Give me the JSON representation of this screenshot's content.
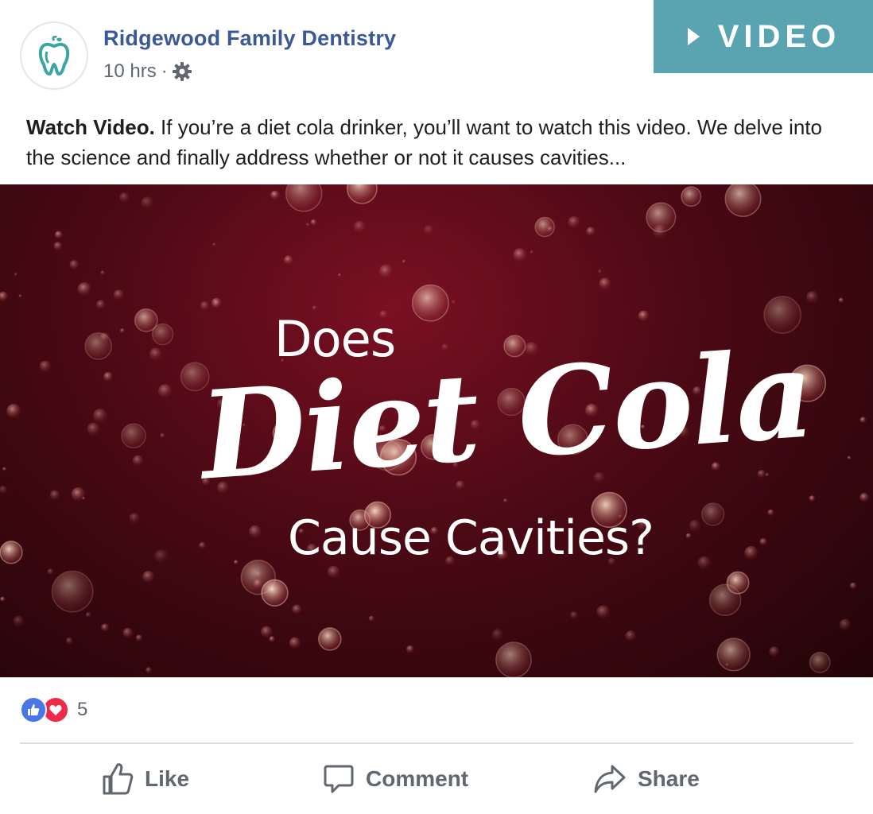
{
  "header": {
    "page_name": "Ridgewood Family Dentistry",
    "timestamp": "10 hrs",
    "separator": "·",
    "avatar_icon": "tooth-logo-icon",
    "privacy_icon": "gear-icon"
  },
  "badge": {
    "label": "VIDEO",
    "icon": "play-triangle-icon",
    "color": "#5aa3b1"
  },
  "post": {
    "lead": "Watch Video.",
    "body": " If you’re a diet cola drinker, you’ll want to watch this video. We delve into the science and finally address whether or not it causes cavities..."
  },
  "media": {
    "line1": "Does",
    "line2": "Diet Cola",
    "line3": "Cause Cavities?",
    "background_color": "#4a0914"
  },
  "reactions": {
    "count": "5",
    "icons": [
      "like-reaction-icon",
      "love-reaction-icon"
    ]
  },
  "actions": [
    {
      "label": "Like",
      "icon": "thumbs-up-icon"
    },
    {
      "label": "Comment",
      "icon": "comment-icon"
    },
    {
      "label": "Share",
      "icon": "share-arrow-icon"
    }
  ],
  "colors": {
    "link": "#3b5998",
    "muted": "#606770",
    "like": "#4a76e8",
    "love": "#f0284a"
  }
}
